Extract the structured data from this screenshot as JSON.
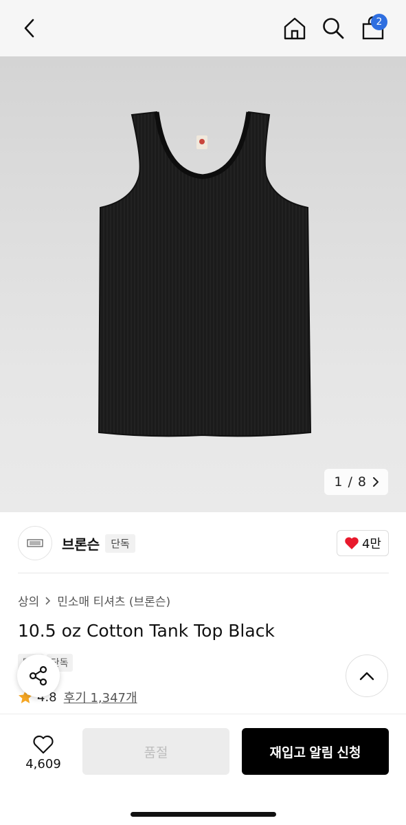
{
  "header": {
    "cart_count": "2",
    "icons": [
      "back-arrow-icon",
      "home-icon",
      "search-icon",
      "shopping-bag-icon"
    ]
  },
  "gallery": {
    "current": "1",
    "separator": "/",
    "total": "8",
    "background": "#dcdcdc"
  },
  "brand": {
    "name": "브론슨",
    "exclusive_label": "단독",
    "like_count": "4만"
  },
  "breadcrumb": {
    "category": "상의",
    "subcategory": "민소매 티셔츠 (브론슨)"
  },
  "product": {
    "title": "10.5 oz Cotton Tank Top Black",
    "tags": [
      "무료",
      "단독"
    ],
    "rating": "4.8",
    "review_label": "후기 1,347개"
  },
  "bottom_bar": {
    "wish_count": "4,609",
    "soldout_label": "품절",
    "restock_label": "재입고 알림 신청"
  },
  "colors": {
    "accent_badge": "#2f6fe0",
    "heart": "#e8192c",
    "star": "#f5a623",
    "primary_button": "#000000"
  }
}
